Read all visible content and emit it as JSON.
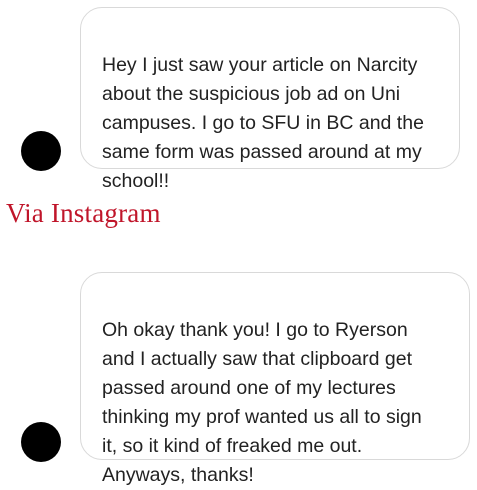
{
  "messages": [
    {
      "text": "Hey I just saw your article on Narcity\nabout the suspicious job ad on Uni\ncampuses. I go to SFU in BC and the\nsame form was passed around at my\nschool!!"
    },
    {
      "text": "Oh okay thank you! I go to Ryerson\nand I actually saw that clipboard get\npassed around one of my lectures\nthinking my prof wanted us all to sign\nit, so it kind of freaked me out.\nAnyways, thanks!"
    }
  ],
  "caption": {
    "text": "Via Instagram",
    "color": "#c0152a"
  },
  "colors": {
    "bubble_border": "#d9d9d9",
    "message_text": "#222222",
    "avatar": "#000000"
  }
}
